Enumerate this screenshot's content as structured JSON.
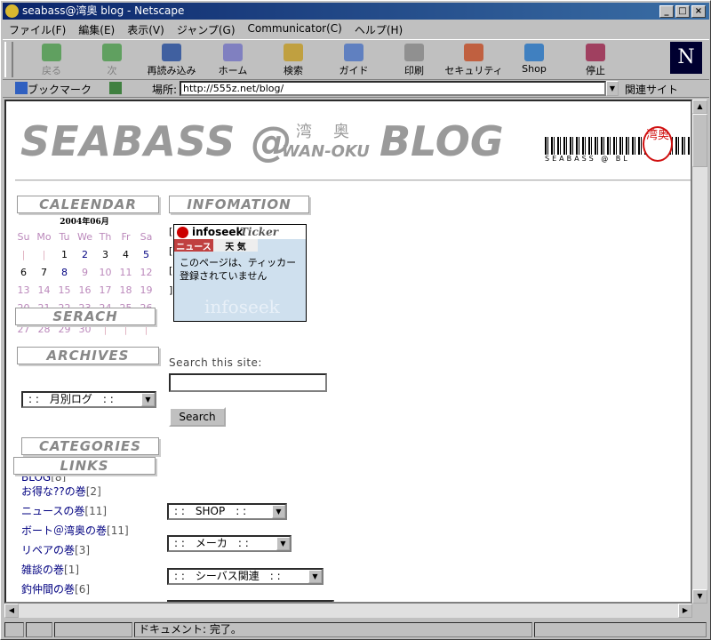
{
  "window": {
    "title": "seabass@湾奥 blog - Netscape"
  },
  "menu": [
    "ファイル(F)",
    "編集(E)",
    "表示(V)",
    "ジャンプ(G)",
    "Communicator(C)",
    "ヘルプ(H)"
  ],
  "toolbar": {
    "back": "戻る",
    "forward": "次",
    "reload": "再読み込み",
    "home": "ホーム",
    "search": "検索",
    "guide": "ガイド",
    "print": "印刷",
    "security": "セキュリティ",
    "shop": "Shop",
    "stop": "停止"
  },
  "location": {
    "bookmarks": "ブックマーク",
    "label": "場所:",
    "url": "http://555z.net/blog/",
    "related": "関連サイト"
  },
  "status": {
    "text": "ドキュメント: 完了。"
  },
  "banner": {
    "logo_left": "SEABASS @",
    "kanji": "湾奥",
    "sub": "WAN-OKU",
    "logo_right": "BLOG",
    "barcode_text": "SEABASS @ BL",
    "stamp": "湾奥"
  },
  "sections": {
    "calendar": "CALEENDAR",
    "infomation": "INFOMATION",
    "serach": "SERACH",
    "archives": "ARCHIVES",
    "categories": "CATEGORIES",
    "links": "LINKS"
  },
  "calendar": {
    "title": "2004年06月",
    "headers": [
      "Su",
      "Mo",
      "Tu",
      "We",
      "Th",
      "Fr",
      "Sa"
    ],
    "row1": [
      "",
      "",
      "1",
      "2",
      "3",
      "4",
      "5"
    ],
    "row2": [
      "6",
      "7",
      "8",
      "9",
      "10",
      "11",
      "12"
    ],
    "row3": [
      "13",
      "14",
      "15",
      "16",
      "17",
      "18",
      "19"
    ],
    "row4": [
      "20",
      "21",
      "22",
      "23",
      "24",
      "25",
      "26"
    ],
    "row5": [
      "27",
      "28",
      "29",
      "30",
      "",
      "",
      ""
    ]
  },
  "archives": {
    "selected": ": :　月別ログ　: :"
  },
  "search": {
    "label": "Search this site:",
    "button": "Search"
  },
  "ticker": {
    "brand": "infoseek",
    "name": "Ticker",
    "tab_news": "ニュース",
    "tab_weather": "天 気",
    "message": "このページは、ティッカー登録されていません",
    "watermark": "infoseek"
  },
  "categories": [
    {
      "label": "BLOG",
      "count": "[8]"
    },
    {
      "label": "お得な??の巻",
      "count": "[2]"
    },
    {
      "label": "ニュースの巻",
      "count": "[11]"
    },
    {
      "label": "ボート＠湾奥の巻",
      "count": "[11]"
    },
    {
      "label": "リペアの巻",
      "count": "[3]"
    },
    {
      "label": "雑談の巻",
      "count": "[1]"
    },
    {
      "label": "釣仲間の巻",
      "count": "[6]"
    }
  ],
  "links": {
    "shop": ": :　SHOP　: :",
    "maker": ": :　メーカ　: :",
    "seabass": ": :　シーバス関連　: :"
  }
}
